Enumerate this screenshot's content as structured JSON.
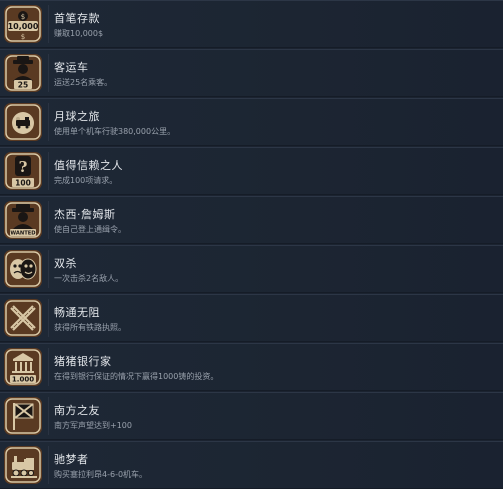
{
  "achievements": [
    {
      "title": "首笔存款",
      "desc": "赚取10,000$",
      "icon": "money-bag-10000-icon",
      "badge": "10,000"
    },
    {
      "title": "客运车",
      "desc": "运送25名乘客。",
      "icon": "passenger-25-icon",
      "badge": "25"
    },
    {
      "title": "月球之旅",
      "desc": "使用单个机车行驶380,000公里。",
      "icon": "moon-train-icon",
      "badge": ""
    },
    {
      "title": "值得信赖之人",
      "desc": "完成100项请求。",
      "icon": "trust-question-100-icon",
      "badge": "100"
    },
    {
      "title": "杰西·詹姆斯",
      "desc": "使自己登上通缉令。",
      "icon": "wanted-poster-icon",
      "badge": "WANTED"
    },
    {
      "title": "双杀",
      "desc": "一次击杀2名敌人。",
      "icon": "double-kill-masks-icon",
      "badge": ""
    },
    {
      "title": "畅通无阻",
      "desc": "获得所有铁路执照。",
      "icon": "crossed-rails-icon",
      "badge": ""
    },
    {
      "title": "猪猪银行家",
      "desc": "在得到银行保证的情况下赢得1000铸的投资。",
      "icon": "bank-1000-icon",
      "badge": "1.000"
    },
    {
      "title": "南方之友",
      "desc": "南方军声望达到+100",
      "icon": "southern-flag-icon",
      "badge": ""
    },
    {
      "title": "驰梦者",
      "desc": "购买塞拉利昂4-6-0机车。",
      "icon": "locomotive-icon",
      "badge": ""
    }
  ],
  "colors": {
    "badge_bg": "#5a3a22",
    "badge_ring": "#d8c7a5",
    "badge_inner": "#1a1614",
    "title": "#e3e6ea",
    "desc": "#9aa2ad"
  }
}
